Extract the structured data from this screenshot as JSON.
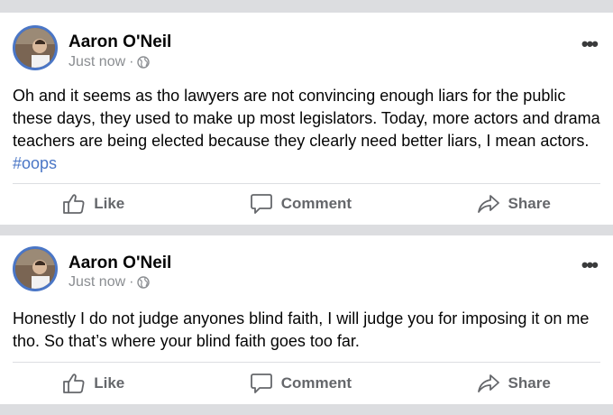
{
  "posts": [
    {
      "author": "Aaron O'Neil",
      "time": "Just now",
      "separator": "·",
      "privacy_icon": "globe-icon",
      "text": "Oh and it seems as tho lawyers are not convincing enough liars for the public these days, they used to make up most legislators. Today, more actors and drama teachers are being elected because they clearly need better liars, I mean actors. ",
      "hashtag": "#oops",
      "actions": {
        "like": "Like",
        "comment": "Comment",
        "share": "Share"
      }
    },
    {
      "author": "Aaron O'Neil",
      "time": "Just now",
      "separator": "·",
      "privacy_icon": "globe-icon",
      "text": "Honestly I do not judge anyones blind faith, I will judge you for imposing it on me tho. So that’s where your blind faith goes too far.",
      "hashtag": "",
      "actions": {
        "like": "Like",
        "comment": "Comment",
        "share": "Share"
      }
    }
  ],
  "colors": {
    "accent": "#4a76c6",
    "muted": "#65676b",
    "background": "#dcdde0"
  }
}
